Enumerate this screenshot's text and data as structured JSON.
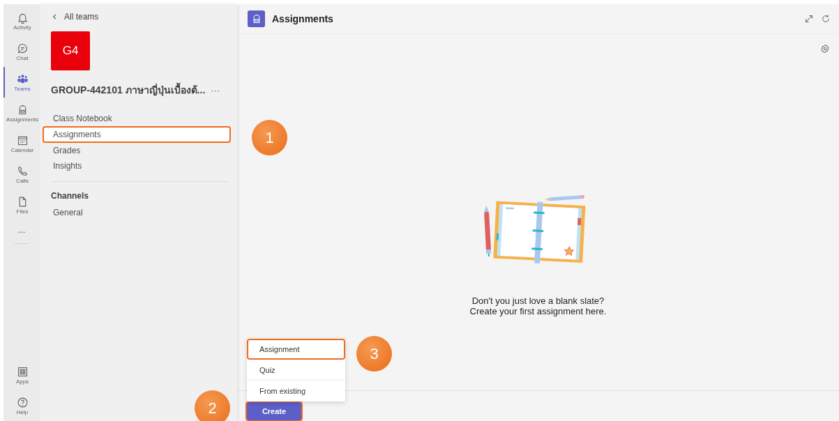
{
  "app_bar": {
    "items": [
      {
        "kind": "activity",
        "label": "Activity",
        "selected": false
      },
      {
        "kind": "chat",
        "label": "Chat",
        "selected": false
      },
      {
        "kind": "teams",
        "label": "Teams",
        "selected": true
      },
      {
        "kind": "assignments",
        "label": "Assignments",
        "selected": false
      },
      {
        "kind": "calendar",
        "label": "Calendar",
        "selected": false
      },
      {
        "kind": "calls",
        "label": "Calls",
        "selected": false
      },
      {
        "kind": "files",
        "label": "Files",
        "selected": false
      }
    ],
    "more": "...",
    "bottom_items": [
      {
        "kind": "apps",
        "label": "Apps"
      },
      {
        "kind": "help",
        "label": "Help"
      }
    ]
  },
  "team_panel": {
    "back": "All teams",
    "avatar": "G4",
    "team_name": "GROUP-442101 ภาษาญี่ปุ่นเบื้องต้...",
    "more": "···",
    "items": [
      {
        "label": "Class Notebook",
        "highlighted": false
      },
      {
        "label": "Assignments",
        "highlighted": true
      },
      {
        "label": "Grades",
        "highlighted": false
      },
      {
        "label": "Insights",
        "highlighted": false
      }
    ],
    "channels_heading": "Channels",
    "channels": [
      {
        "label": "General"
      }
    ]
  },
  "main": {
    "title": "Assignments",
    "empty_state": [
      "Don't you just love a blank slate?",
      "Create your first assignment here."
    ],
    "create_menu": [
      {
        "label": "Assignment",
        "highlighted": true
      },
      {
        "label": "Quiz",
        "highlighted": false
      },
      {
        "label": "From existing",
        "highlighted": false
      }
    ],
    "create_button": {
      "label": "Create",
      "highlighted": true
    }
  },
  "callouts": [
    {
      "label": "1",
      "kind": "nav"
    },
    {
      "label": "2",
      "kind": "create"
    },
    {
      "label": "3",
      "kind": "menu"
    }
  ]
}
